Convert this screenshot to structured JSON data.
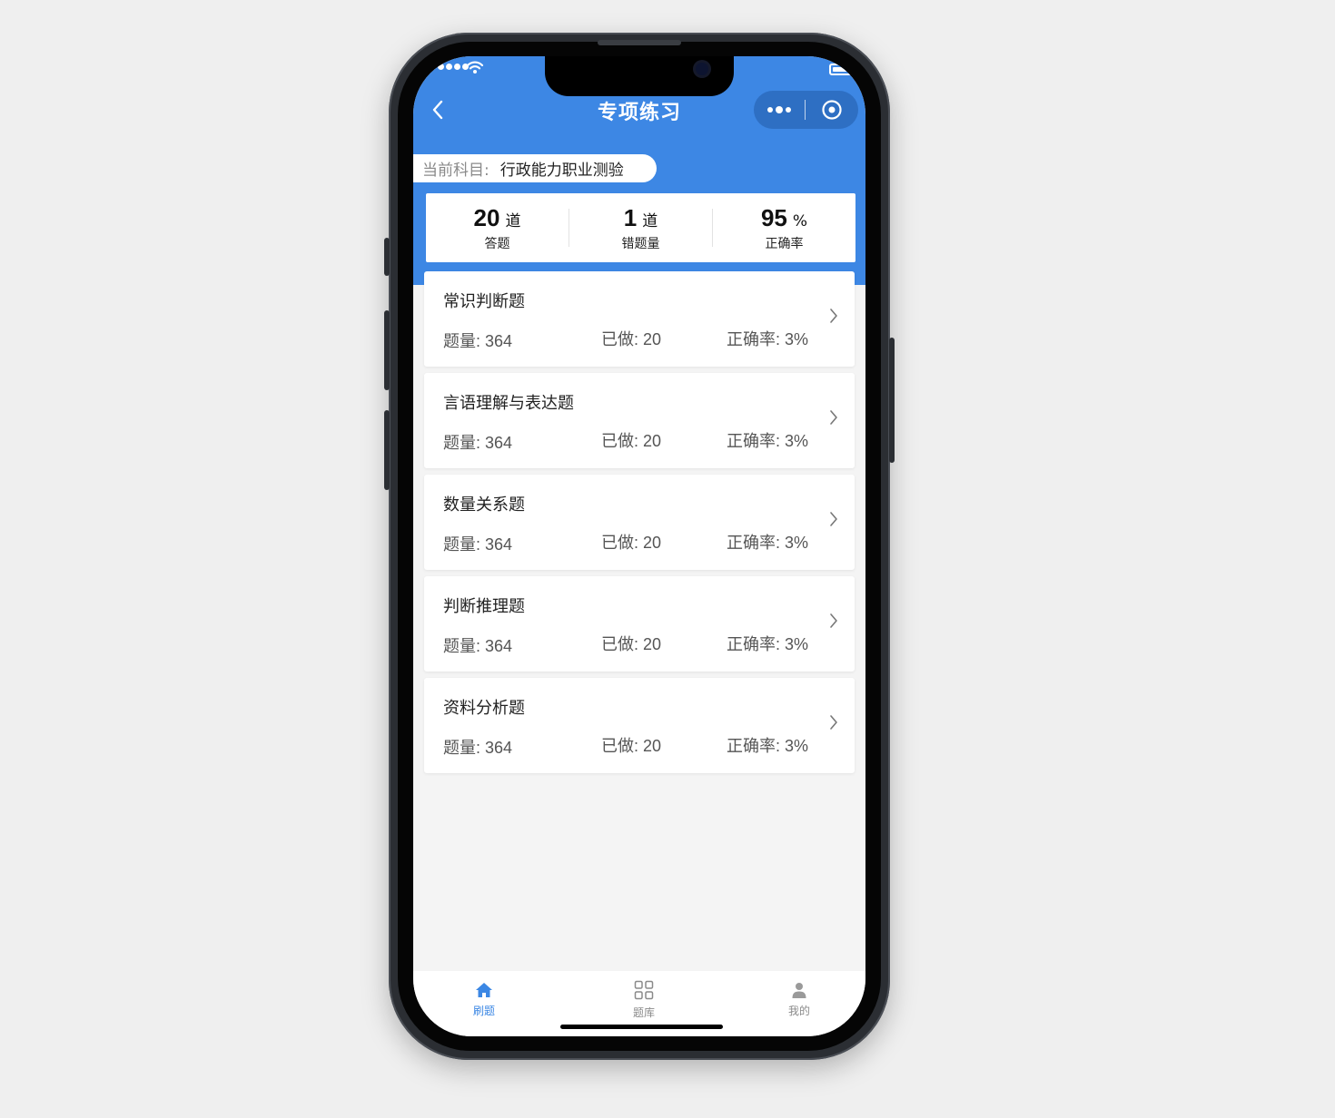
{
  "nav": {
    "title": "专项练习"
  },
  "subject": {
    "label": "当前科目:",
    "value": "行政能力职业测验"
  },
  "stats": [
    {
      "value": "20",
      "unit": "道",
      "label": "答题"
    },
    {
      "value": "1",
      "unit": "道",
      "label": "错题量"
    },
    {
      "value": "95",
      "unit": "%",
      "label": "正确率"
    }
  ],
  "categories": [
    {
      "title": "常识判断题",
      "total": "题量: 364",
      "done": "已做: 20",
      "accuracy": "正确率: 3%"
    },
    {
      "title": "言语理解与表达题",
      "total": "题量: 364",
      "done": "已做: 20",
      "accuracy": "正确率: 3%"
    },
    {
      "title": "数量关系题",
      "total": "题量: 364",
      "done": "已做: 20",
      "accuracy": "正确率: 3%"
    },
    {
      "title": "判断推理题",
      "total": "题量: 364",
      "done": "已做: 20",
      "accuracy": "正确率: 3%"
    },
    {
      "title": "资料分析题",
      "total": "题量: 364",
      "done": "已做: 20",
      "accuracy": "正确率: 3%"
    }
  ],
  "tabbar": {
    "items": [
      {
        "label": "刷题",
        "icon": "home-icon",
        "active": true
      },
      {
        "label": "题库",
        "icon": "grid-icon",
        "active": false
      },
      {
        "label": "我的",
        "icon": "user-icon",
        "active": false
      }
    ]
  },
  "colors": {
    "primary": "#3d87e4",
    "background": "#f4f4f4",
    "capsule": "#2e6fc3"
  }
}
